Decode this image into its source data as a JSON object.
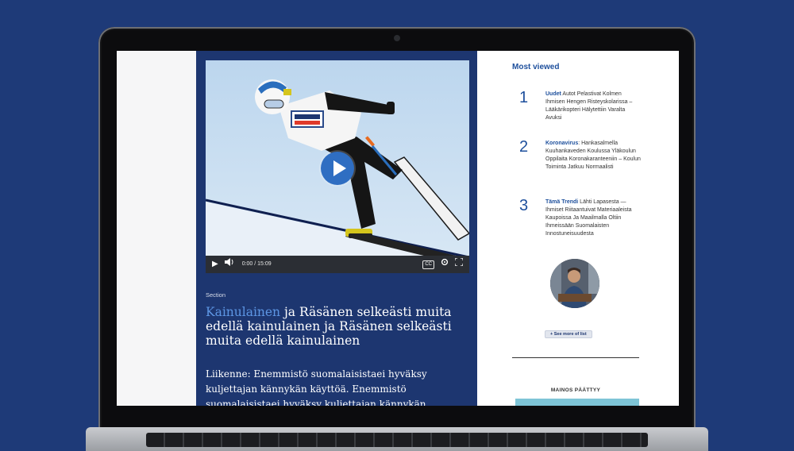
{
  "video": {
    "time": "0:00 / 15:09",
    "cc_label": "CC"
  },
  "article": {
    "section": "Section",
    "headline_accent": "Kainulainen",
    "headline_rest": " ja Räsänen selkeästi muita edellä kainulainen ja Räsänen selkeästi muita edellä kainulainen",
    "lead": "Liikenne: Enemmistö suomalaisistaei hyväksy kuljettajan kännykän käyttöä. Enemmistö suomalaisistaei hyväksy kuljettajan kännykän."
  },
  "most_viewed": {
    "title": "Most viewed",
    "items": [
      {
        "rank": "1",
        "category": "Uudet",
        "text": " Autot Pelastivat Kolmen Ihmisen Hengen Risteyskolarissa – Lääkärikopteri Hälytettiin Varalta Avuksi"
      },
      {
        "rank": "2",
        "category": "Koronavirus",
        "text": ": Hankasalmella Kuuhankaveden Koulussa Yläkoulun Oppilaita Koronakaranteeniin – Koulun Toiminta Jatkuu Normaalisti"
      },
      {
        "rank": "3",
        "category": "Tämä Trendi",
        "text": " Lähti Lapasesta —Ihmiset Riitaantuivat Materiaaleista Kaupoissa Ja Maailmalla Oltiin Ihmeissään Suomalaisten Innostuneisuudesta"
      }
    ],
    "see_more": "+ See more of list"
  },
  "ad": {
    "label": "MAINOS PÄÄTTYY"
  },
  "colors": {
    "background": "#1e3a78",
    "article_bg": "#1d3670",
    "accent": "#5d96e4",
    "link": "#1d4f9c",
    "play_button": "#2f6ec2",
    "ad_bar": "#7ec4d6"
  },
  "icons": [
    "play-icon",
    "volume-icon",
    "settings-icon",
    "fullscreen-icon",
    "play-overlay-icon"
  ]
}
